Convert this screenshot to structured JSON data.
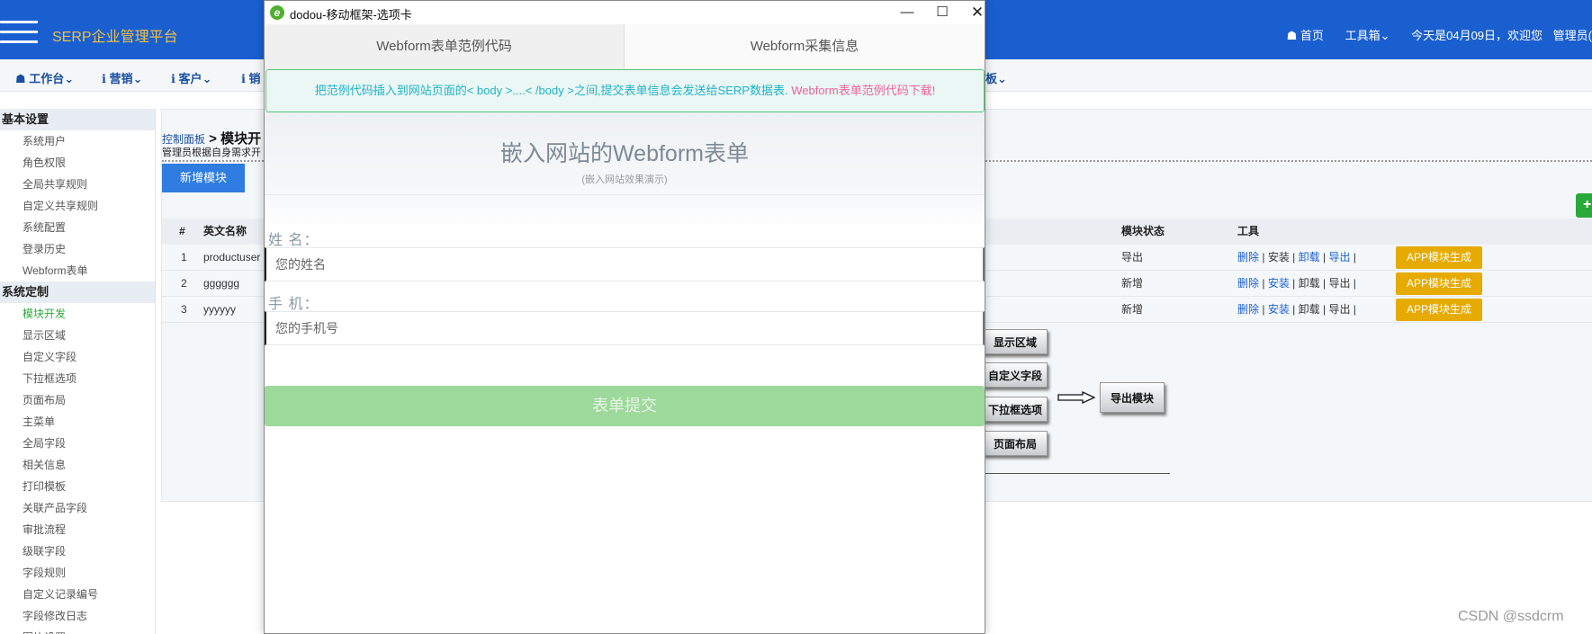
{
  "app": {
    "brand": "SERP企业管理平台",
    "topnav": {
      "home": "☗ 首页",
      "tools": "工具箱",
      "greeting": "今天是04月09日，欢迎您",
      "user": "管理员("
    }
  },
  "menu": [
    "☗ 工作台",
    "ℹ 营销",
    "ℹ 客户",
    "ℹ 销"
  ],
  "menu_tail": "板",
  "sidebar": {
    "groups": [
      {
        "label": "基本设置",
        "items": [
          "系统用户",
          "角色权限",
          "全局共享规则",
          "自定义共享规则",
          "系统配置",
          "登录历史",
          "Webform表单"
        ]
      },
      {
        "label": "系统定制",
        "items": [
          "模块开发",
          "显示区域",
          "自定义字段",
          "下拉框选项",
          "页面布局",
          "主菜单",
          "全局字段",
          "相关信息",
          "打印模板",
          "关联产品字段",
          "审批流程",
          "级联字段",
          "字段规则",
          "自定义记录编号",
          "字段修改日志",
          "图片设置"
        ]
      }
    ],
    "active_item": "模块开发"
  },
  "page": {
    "breadcrumb_link": "控制面板",
    "breadcrumb_sep": " > ",
    "breadcrumb_current": "模块开",
    "description": "管理员根据自身需求开",
    "add_button": "新增模块",
    "green_button": "+"
  },
  "table": {
    "headers": {
      "num": "#",
      "name": "英文名称",
      "status": "模块状态",
      "tools": "工具"
    },
    "rows": [
      {
        "num": "1",
        "name": "productuser",
        "status": "导出",
        "app": "APP模块生成",
        "tools_links": [
          true,
          false,
          true,
          true
        ]
      },
      {
        "num": "2",
        "name": "gggggg",
        "status": "新增",
        "app": "APP模块生成",
        "tools_links": [
          true,
          true,
          false,
          false
        ]
      },
      {
        "num": "3",
        "name": "yyyyyy",
        "status": "新增",
        "app": "APP模块生成",
        "tools_links": [
          true,
          true,
          false,
          false
        ]
      }
    ],
    "tool_labels": [
      "删除",
      "安装",
      "卸载",
      "导出"
    ]
  },
  "diagram": {
    "boxes": [
      "显示区域",
      "自定义字段",
      "下拉框选项",
      "页面布局"
    ],
    "export_box": "导出模块"
  },
  "modal": {
    "icon": "e",
    "title": "dodou-移动框架-选项卡",
    "tabs": [
      "Webform表单范例代码",
      "Webform采集信息"
    ],
    "notice_text": "把范例代码插入到网站页面的< body >....< /body >之间,提交表单信息会发送给SERP数据表.",
    "notice_link": "Webform表单范例代码下载!",
    "form_title": "嵌入网站的Webform表单",
    "form_subtitle": "(嵌入网站效果演示)",
    "name_label": "姓 名：",
    "name_placeholder": "您的姓名",
    "phone_label": "手 机：",
    "phone_placeholder": "您的手机号",
    "submit": "表单提交"
  },
  "watermark": "CSDN @ssdcrm"
}
